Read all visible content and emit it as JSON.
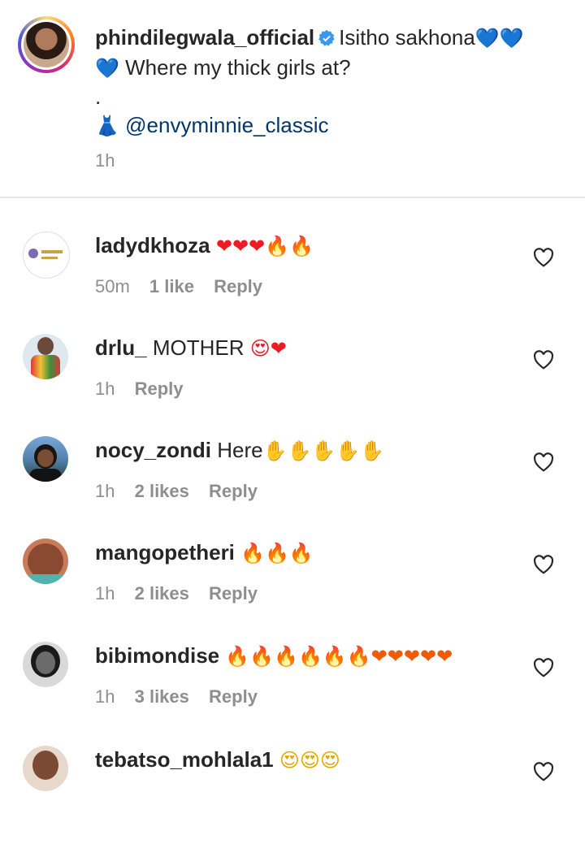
{
  "post": {
    "username": "phindilegwala_official",
    "caption_line1": "Isitho sakhona",
    "caption_line1_emoji": "💙💙",
    "caption_line2_emoji": "💙",
    "caption_line2": "Where my thick girls at?",
    "caption_dot": ".",
    "dress_emoji": "👗",
    "mention": "@envyminnie_classic",
    "time": "1h"
  },
  "comments": [
    {
      "username": "ladydkhoza",
      "text": "",
      "emoji": "❤❤❤🔥🔥",
      "time": "50m",
      "likes": "1 like",
      "reply": "Reply"
    },
    {
      "username": "drlu_",
      "text": "MOTHER",
      "emoji": "😍❤",
      "time": "1h",
      "likes": "",
      "reply": "Reply"
    },
    {
      "username": "nocy_zondi",
      "text": "Here",
      "emoji": "✋✋✋✋✋",
      "time": "1h",
      "likes": "2 likes",
      "reply": "Reply"
    },
    {
      "username": "mangopetheri",
      "text": "",
      "emoji": "🔥🔥🔥",
      "time": "1h",
      "likes": "2 likes",
      "reply": "Reply"
    },
    {
      "username": "bibimondise",
      "text": "",
      "emoji": "🔥🔥🔥🔥🔥🔥❤❤❤❤❤",
      "time": "1h",
      "likes": "3 likes",
      "reply": "Reply"
    },
    {
      "username": "tebatso_mohlala1",
      "text": "",
      "emoji": "😍😍😍",
      "time": "",
      "likes": "",
      "reply": ""
    }
  ],
  "icons": {
    "verified": "verified-badge-icon",
    "like": "heart-outline-icon"
  },
  "colors": {
    "mention": "#00376b",
    "meta": "#8e8e8e",
    "verified": "#3897f0"
  }
}
